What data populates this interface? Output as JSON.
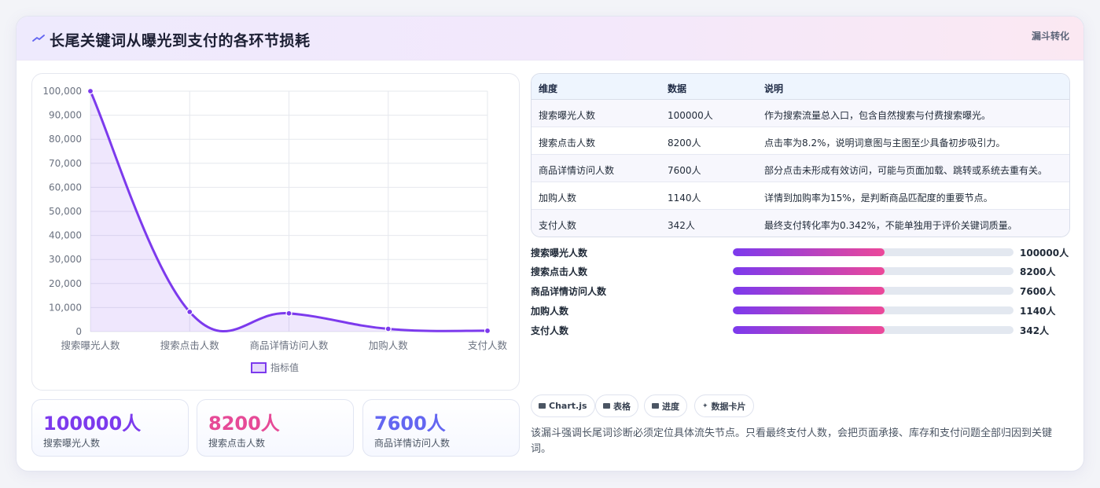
{
  "header": {
    "title": "长尾关键词从曝光到支付的各环节损耗",
    "tag": "漏斗转化",
    "icon": "trend-line-icon"
  },
  "chart_data": {
    "type": "line",
    "categories": [
      "搜索曝光人数",
      "搜索点击人数",
      "商品详情访问人数",
      "加购人数",
      "支付人数"
    ],
    "series": [
      {
        "name": "指标值",
        "values": [
          100000,
          8200,
          7600,
          1140,
          342
        ]
      }
    ],
    "ylim": [
      0,
      100000
    ],
    "yticks": [
      "0",
      "10,000",
      "20,000",
      "30,000",
      "40,000",
      "50,000",
      "60,000",
      "70,000",
      "80,000",
      "90,000",
      "100,000"
    ],
    "smooth": true,
    "filled": true,
    "grid": true,
    "legend": "bottom",
    "color": "#7c3aed"
  },
  "stats": [
    {
      "value": "100000人",
      "label": "搜索曝光人数",
      "color": "#7c3aed"
    },
    {
      "value": "8200人",
      "label": "搜索点击人数",
      "color": "#e64a97"
    },
    {
      "value": "7600人",
      "label": "商品详情访问人数",
      "color": "#6366f1"
    }
  ],
  "table": {
    "headers": [
      "维度",
      "数据",
      "说明"
    ],
    "rows": [
      [
        "搜索曝光人数",
        "100000人",
        "作为搜索流量总入口，包含自然搜索与付费搜索曝光。"
      ],
      [
        "搜索点击人数",
        "8200人",
        "点击率为8.2%，说明词意图与主图至少具备初步吸引力。"
      ],
      [
        "商品详情访问人数",
        "7600人",
        "部分点击未形成有效访问，可能与页面加载、跳转或系统去重有关。"
      ],
      [
        "加购人数",
        "1140人",
        "详情到加购率为15%，是判断商品匹配度的重要节点。"
      ],
      [
        "支付人数",
        "342人",
        "最终支付转化率为0.342%，不能单独用于评价关键词质量。"
      ]
    ]
  },
  "progress": [
    {
      "label": "搜索曝光人数",
      "value": "100000人",
      "fill": 0.54
    },
    {
      "label": "搜索点击人数",
      "value": "8200人",
      "fill": 0.54
    },
    {
      "label": "商品详情访问人数",
      "value": "7600人",
      "fill": 0.54
    },
    {
      "label": "加购人数",
      "value": "1140人",
      "fill": 0.54
    },
    {
      "label": "支付人数",
      "value": "342人",
      "fill": 0.54
    }
  ],
  "chips": [
    {
      "label": "Chart.js",
      "icon": "chart-icon"
    },
    {
      "label": "表格",
      "icon": "table-icon"
    },
    {
      "label": "进度",
      "icon": "progress-icon"
    },
    {
      "label": "数据卡片",
      "icon": "sparkle-icon"
    }
  ],
  "note": "该漏斗强调长尾词诊断必须定位具体流失节点。只看最终支付人数，会把页面承接、库存和支付问题全部归因到关键词。"
}
